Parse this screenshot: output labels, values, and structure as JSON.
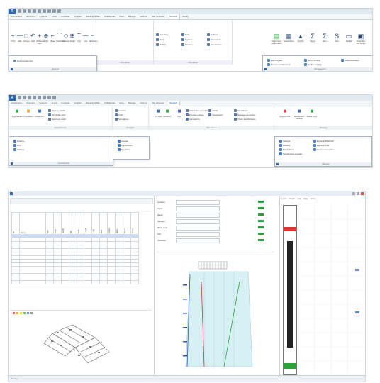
{
  "ribbon1": {
    "tabs": [
      "Architecture",
      "Structure",
      "Systems",
      "Insert",
      "Annotate",
      "Analyze",
      "Massing & Site",
      "Collaborate",
      "View",
      "Manage",
      "Add-Ins",
      "Site Structure",
      "StruSoft",
      "Modify"
    ],
    "active_tab": "StruSoft",
    "tools": [
      "Point",
      "Slab",
      "Change",
      "Void",
      "Additional lines",
      "Solid",
      "Base",
      "Subdivision",
      "Canvas",
      "Terrain",
      "Text",
      "Line",
      "Tabulation"
    ],
    "panel_labels": [
      "Terrain and Site Objects",
      "Annotation",
      "Annotation",
      "Management"
    ],
    "annotation_items": [
      "Text Rows",
      "Mark",
      "Multiply",
      "Tools",
      "Position",
      "Sections",
      "Outlines",
      "Dimensions",
      "Connections"
    ],
    "mgmt_buttons": [
      "Assignment configuration",
      "Specification",
      "Symbol",
      "Sigma",
      "Sum",
      "Start",
      "Toolbar",
      "Properties and values"
    ],
    "mgmt_dropdown": [
      "Edit template",
      "Property configuration",
      "Mass counting",
      "Section reading",
      "Data preparation"
    ],
    "left_dropdown": "Tool management",
    "left_dropdown_foot": "Settings"
  },
  "ribbon2": {
    "tabs": [
      "Architecture",
      "Structure",
      "Systems",
      "Insert",
      "Annotate",
      "Analyze",
      "Massing & Site",
      "Collaborate",
      "View",
      "Manage",
      "Add-Ins",
      "Site Structure",
      "StruSoft"
    ],
    "active_tab": "StruSoft",
    "big_tools": [
      "Specification",
      "Foundation",
      "Geotechnic",
      "Soil layer",
      "Elevation",
      "Piles",
      "Reports PDF",
      "Specification manager",
      "Delete entity"
    ],
    "small_tools": [
      "Opening depth",
      "Set profile color",
      "Maximum depth",
      "Analysis",
      "Insert",
      "Simulations",
      "Coordinate generation",
      "Elevation design",
      "Annotations",
      "Labels",
      "Connections",
      "Simulations",
      "Message generation",
      "Check specifications"
    ],
    "panel_labels": [
      "Geotechnics",
      "Analysis",
      "Simulation",
      "Manage"
    ],
    "drop_left": [
      "Drawing",
      "HTC",
      "Settings"
    ],
    "drop_left_foot": "Geotechnical",
    "drop_mid": [
      "Allocate",
      "Specification",
      "Simulation"
    ],
    "drop_right": [
      "Settings",
      "Markers",
      "Export Excel",
      "Specification template",
      "Export to BSG/DXF",
      "Export to SSF",
      "Report presentation"
    ],
    "drop_right_foot": "Manage"
  },
  "app": {
    "columns_left": [
      "No",
      "Name",
      "Type",
      "Level",
      "Depth",
      "Pile",
      "Width",
      "Length",
      "Load",
      "Area",
      "Volume",
      "Mass",
      "Check",
      "Status"
    ],
    "rows": 14,
    "form_labels": [
      "Location",
      "Layer",
      "Depth",
      "Strength",
      "Water level",
      "Soil",
      "Comment"
    ],
    "right_headers": [
      "Levels",
      "Depth",
      "Unit",
      "Value",
      "Notes"
    ],
    "status_left": "Ready"
  },
  "colors": {
    "accent": "#2b66b2",
    "green": "#27a33a",
    "red": "#e03333",
    "blue": "#2e56c9"
  }
}
